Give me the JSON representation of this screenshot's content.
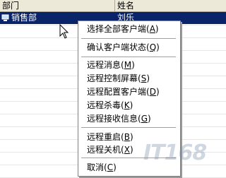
{
  "columns": {
    "dept": "部门",
    "name": "姓名"
  },
  "selected_row": {
    "dept": "销售部",
    "name": "刘乐"
  },
  "context_menu": {
    "items": [
      {
        "label": "选择全部客户端",
        "key": "A"
      },
      {
        "label": "确认客户端状态",
        "key": "Q"
      },
      {
        "label": "远程消息",
        "key": "M"
      },
      {
        "label": "远程控制屏幕",
        "key": "S"
      },
      {
        "label": "远程配置客户端",
        "key": "D"
      },
      {
        "label": "远程杀毒",
        "key": "K"
      },
      {
        "label": "远程接收信息",
        "key": "G"
      },
      {
        "label": "远程重启",
        "key": "B"
      },
      {
        "label": "远程关机",
        "key": "X"
      },
      {
        "label": "取消",
        "key": "C"
      }
    ]
  },
  "watermark": "IT168",
  "colors": {
    "selection": "#0a246a",
    "header_bg": "#ece9d8"
  }
}
